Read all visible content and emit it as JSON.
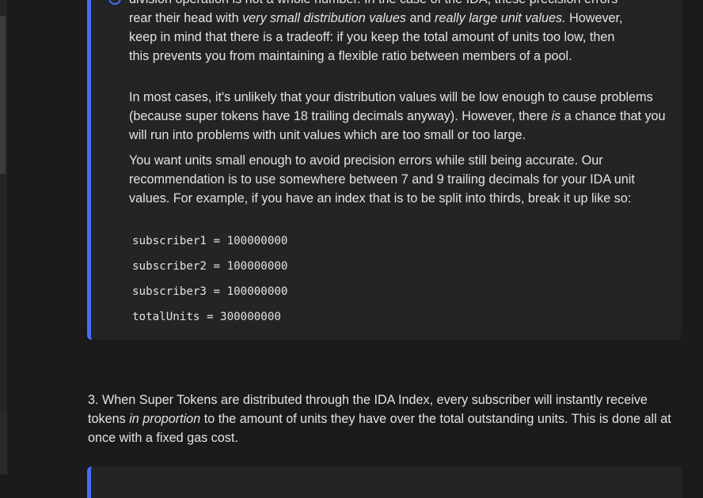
{
  "admonition": {
    "para1": {
      "line0": "division operation is not a whole number. In the case of the IDA, these precision errors",
      "line1_a": "rear their head with ",
      "line1_em1": "very small distribution values",
      "line1_b": " and ",
      "line1_em2": "really large unit values.",
      "line1_c": " However,",
      "line2": "keep in mind that there is a tradeoff: if you keep the total amount of units too low, then",
      "line3": "this prevents you from maintaining a flexible ratio between members of a pool."
    },
    "para2": {
      "text_a": "In most cases, it's unlikely that your distribution values will be low enough to cause problems (because super tokens have 18 trailing decimals anyway). However, there ",
      "em": "is",
      "text_b": " a chance that you will run into problems with unit values which are too small or too large."
    },
    "para3": "You want units small enough to avoid precision errors while still being accurate. Our recommendation is to use somewhere between 7 and 9 trailing decimals for your IDA unit values. For example, if you have an index that is to be split into thirds, break it up like so:",
    "code": [
      "subscriber1 = 100000000",
      "subscriber2 = 100000000",
      "subscriber3 = 100000000",
      "totalUnits = 300000000"
    ]
  },
  "main": {
    "step3_a": "3. When Super Tokens are distributed through the IDA Index, every subscriber will instantly receive tokens ",
    "step3_em": "in proportion",
    "step3_b": " to the amount of units they have over the total outstanding units. This is done all at once with a fixed gas cost."
  },
  "colors": {
    "background": "#1b1b1d",
    "admonition_bg": "#222426",
    "accent": "#4a6cf7",
    "text": "#e3e3e3"
  }
}
